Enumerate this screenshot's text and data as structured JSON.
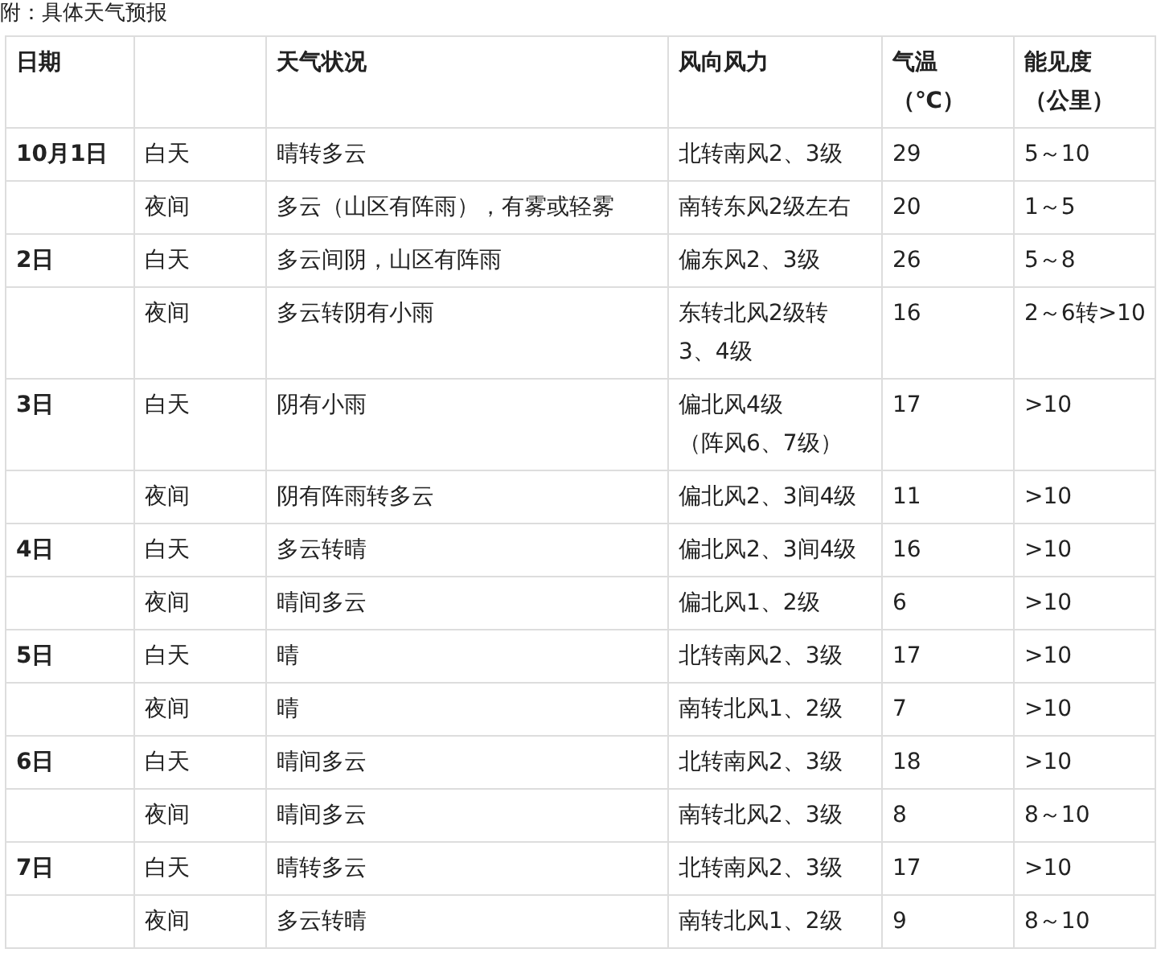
{
  "caption": "附：具体天气预报",
  "columns": [
    [
      "日期"
    ],
    [],
    [
      "天气状况"
    ],
    [
      "风向风力"
    ],
    [
      "气温",
      "（℃）"
    ],
    [
      "能见度",
      "（公里）"
    ]
  ],
  "days": [
    {
      "date": "10月1日",
      "periods": [
        {
          "period": "白天",
          "weather": "晴转多云",
          "wind": "北转南风2、3级",
          "temp": "29",
          "visibility": "5～10"
        },
        {
          "period": "夜间",
          "weather": "多云（山区有阵雨），有雾或轻雾",
          "wind": "南转东风2级左右",
          "temp": "20",
          "visibility": "1～5"
        }
      ]
    },
    {
      "date": "2日",
      "periods": [
        {
          "period": "白天",
          "weather": "多云间阴，山区有阵雨",
          "wind": "偏东风2、3级",
          "temp": "26",
          "visibility": "5～8"
        },
        {
          "period": "夜间",
          "weather": "多云转阴有小雨",
          "wind": [
            "东转北风2级转",
            "3、4级"
          ],
          "temp": "16",
          "visibility": "2～6转>10"
        }
      ]
    },
    {
      "date": "3日",
      "periods": [
        {
          "period": "白天",
          "weather": "阴有小雨",
          "wind": [
            "偏北风4级",
            "（阵风6、7级）"
          ],
          "temp": "17",
          "visibility": ">10"
        },
        {
          "period": "夜间",
          "weather": "阴有阵雨转多云",
          "wind": "偏北风2、3间4级",
          "temp": "11",
          "visibility": ">10"
        }
      ]
    },
    {
      "date": "4日",
      "periods": [
        {
          "period": "白天",
          "weather": "多云转晴",
          "wind": "偏北风2、3间4级",
          "temp": "16",
          "visibility": ">10"
        },
        {
          "period": "夜间",
          "weather": "晴间多云",
          "wind": "偏北风1、2级",
          "temp": "6",
          "visibility": ">10"
        }
      ]
    },
    {
      "date": "5日",
      "periods": [
        {
          "period": "白天",
          "weather": "晴",
          "wind": "北转南风2、3级",
          "temp": "17",
          "visibility": ">10"
        },
        {
          "period": "夜间",
          "weather": "晴",
          "wind": "南转北风1、2级",
          "temp": "7",
          "visibility": ">10"
        }
      ]
    },
    {
      "date": "6日",
      "periods": [
        {
          "period": "白天",
          "weather": "晴间多云",
          "wind": "北转南风2、3级",
          "temp": "18",
          "visibility": ">10"
        },
        {
          "period": "夜间",
          "weather": "晴间多云",
          "wind": "南转北风2、3级",
          "temp": "8",
          "visibility": "8～10"
        }
      ]
    },
    {
      "date": "7日",
      "periods": [
        {
          "period": "白天",
          "weather": "晴转多云",
          "wind": "北转南风2、3级",
          "temp": "17",
          "visibility": ">10"
        },
        {
          "period": "夜间",
          "weather": "多云转晴",
          "wind": "南转北风1、2级",
          "temp": "9",
          "visibility": "8～10"
        }
      ]
    }
  ]
}
